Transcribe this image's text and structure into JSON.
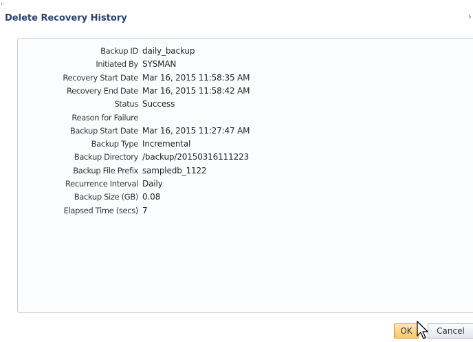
{
  "dialog": {
    "title": "Delete Recovery History",
    "close_glyph": "›"
  },
  "details": [
    {
      "label": "Backup ID",
      "value": "daily_backup"
    },
    {
      "label": "Initiated By",
      "value": "SYSMAN"
    },
    {
      "label": "Recovery Start Date",
      "value": "Mar 16, 2015 11:58:35 AM"
    },
    {
      "label": "Recovery End Date",
      "value": "Mar 16, 2015 11:58:42 AM"
    },
    {
      "label": "Status",
      "value": "Success"
    },
    {
      "label": "Reason for Failure",
      "value": ""
    },
    {
      "label": "Backup Start Date",
      "value": "Mar 16, 2015 11:27:47 AM"
    },
    {
      "label": "Backup Type",
      "value": "Incremental"
    },
    {
      "label": "Backup Directory",
      "value": "/backup/20150316111223"
    },
    {
      "label": "Backup File Prefix",
      "value": "sampledb_1122"
    },
    {
      "label": "Recurrence Interval",
      "value": "Daily"
    },
    {
      "label": "Backup Size (GB)",
      "value": "0.08"
    },
    {
      "label": "Elapsed Time (secs)",
      "value": "7"
    }
  ],
  "buttons": {
    "ok_label": "OK",
    "cancel_label": "Cancel"
  },
  "icons": {
    "close": "close-icon",
    "cursor": "mouse-pointer-icon"
  },
  "colors": {
    "title": "#2a3f6b",
    "ok_button": "#f7c86f",
    "panel_border": "#c3ccd6"
  }
}
